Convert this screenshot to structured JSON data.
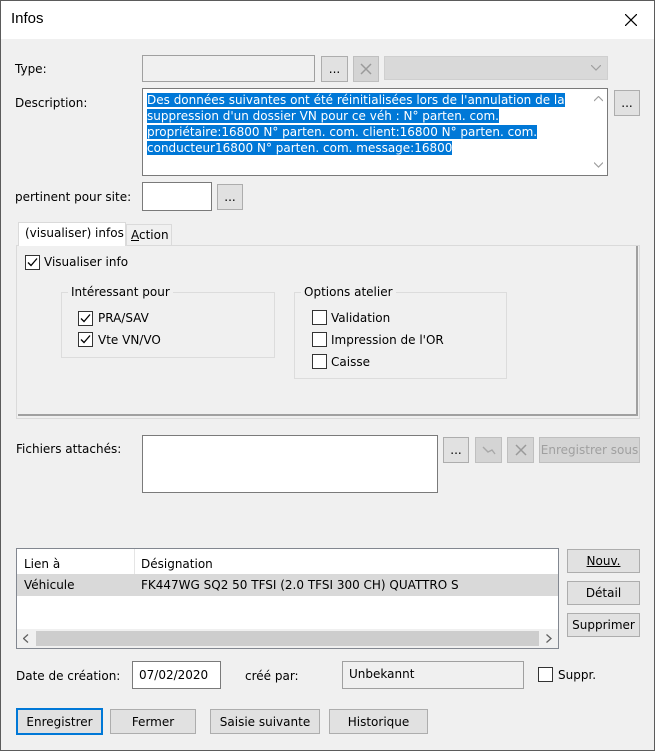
{
  "window": {
    "title": "Infos"
  },
  "form": {
    "type_label": "Type:",
    "type_value": "",
    "ellipsis": "...",
    "description_label": "Description:",
    "description_lines": [
      "Des données suivantes ont été réinitialisées lors de l'annulation de la",
      "suppression d'un dossier VN pour ce véh : N° parten. com.",
      "propriétaire:16800 N° parten. com. client:16800 N° parten. com.",
      "conducteur16800 N° parten. com. message:16800"
    ],
    "site_label": "pertinent pour site:",
    "site_value": ""
  },
  "tabs": [
    {
      "label": "(visualiser) infos"
    },
    {
      "label": "Action",
      "accel": "A",
      "rest": "ction"
    }
  ],
  "panel": {
    "visualiser_label": "Visualiser info",
    "visualiser_checked": true,
    "interessant": {
      "title": "Intéressant pour",
      "items": [
        {
          "label": "PRA/SAV",
          "checked": true
        },
        {
          "label": "Vte VN/VO",
          "checked": true
        }
      ]
    },
    "options": {
      "title": "Options atelier",
      "items": [
        {
          "label": "Validation",
          "checked": false
        },
        {
          "label": "Impression de l'OR",
          "checked": false
        },
        {
          "label": "Caisse",
          "checked": false
        }
      ]
    }
  },
  "fichiers": {
    "label": "Fichiers attachés:",
    "save_as": "Enregistrer sous"
  },
  "links_table": {
    "columns": [
      "Lien à",
      "Désignation"
    ],
    "rows": [
      {
        "lien": "Véhicule",
        "designation": "FK447WG SQ2 50 TFSI (2.0 TFSI 300 CH) QUATTRO S"
      }
    ]
  },
  "side_buttons": {
    "nouv": "Nouv.",
    "detail": "Détail",
    "supprimer": "Supprimer"
  },
  "footer": {
    "date_label": "Date de création:",
    "date_value": "07/02/2020",
    "cree_label": "créé par:",
    "cree_value": "Unbekannt",
    "suppr_label": "Suppr.",
    "suppr_checked": false
  },
  "actions": {
    "enregistrer": "Enregistrer",
    "fermer": "Fermer",
    "saisie": "Saisie suivante",
    "historique": "Historique"
  }
}
